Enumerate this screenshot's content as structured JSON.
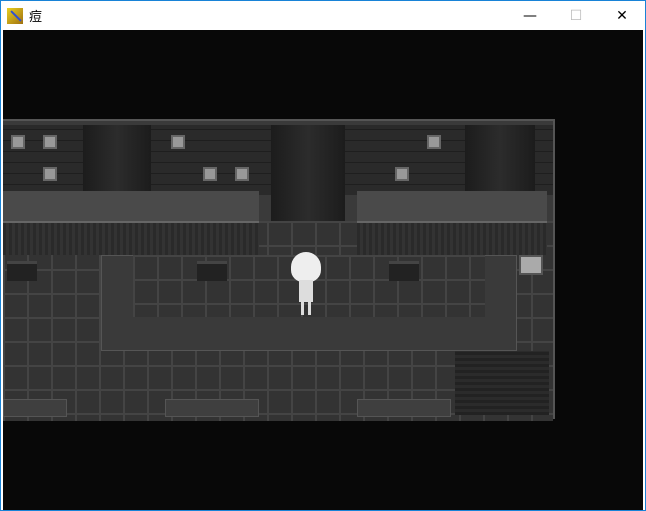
{
  "window": {
    "title": "痘",
    "controls": {
      "minimize": "—",
      "maximize": "☐",
      "close": "✕"
    }
  }
}
